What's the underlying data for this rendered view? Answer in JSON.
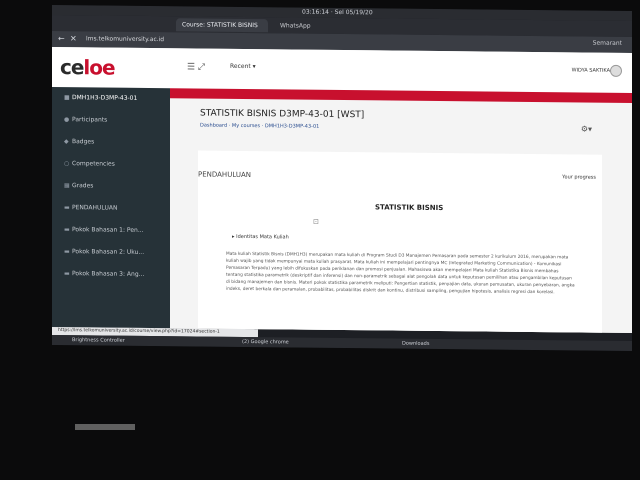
{
  "system": {
    "clock": "03:16:14 · Sel 05/19/20"
  },
  "browser": {
    "tabs": [
      {
        "label": "Course: STATISTIK BISNIS"
      },
      {
        "label": "WhatsApp"
      }
    ],
    "address": "lms.telkomuniversity.ac.id",
    "account": "Semarant",
    "status_url": "https://lms.telkomuniversity.ac.id/course/view.php?id=17024#section-1"
  },
  "site": {
    "logo_left": "ce",
    "logo_right": "loe",
    "recent_label": "Recent",
    "user_name": "WIDYA SAKTIKA"
  },
  "sidebar": {
    "items": [
      {
        "label": "DMH1H3-D3MP-43-01",
        "icon": "hat-icon"
      },
      {
        "label": "Participants",
        "icon": "users-icon"
      },
      {
        "label": "Badges",
        "icon": "badge-icon"
      },
      {
        "label": "Competencies",
        "icon": "check-icon"
      },
      {
        "label": "Grades",
        "icon": "grades-icon"
      },
      {
        "label": "PENDAHULUAN",
        "icon": "folder-icon"
      },
      {
        "label": "Pokok Bahasan 1: Pen...",
        "icon": "folder-icon"
      },
      {
        "label": "Pokok Bahasan 2: Uku...",
        "icon": "folder-icon"
      },
      {
        "label": "Pokok Bahasan 3: Ang...",
        "icon": "folder-icon"
      }
    ]
  },
  "course": {
    "title": "STATISTIK BISNIS D3MP-43-01 [WST]",
    "breadcrumb": [
      "Dashboard",
      "My courses",
      "DMH1H3-D3MP-43-01"
    ],
    "section_title": "PENDAHULUAN",
    "progress_label": "Your progress",
    "heading": "STATISTIK BISNIS",
    "identitas_label": "Identitas Mata Kuliah",
    "paragraph": "Mata kuliah Statistik Bisnis (DMH1H3) merupakan mata kuliah di Program Studi D3 Manajemen Pemasaran pada semester 2 kurikulum 2016, merupakan mata kuliah wajib yang tidak mempunyai mata kuliah prasyarat. Mata kuliah ini mempelajari pentingnya MC (Integrated Marketing Communication) - Komunikasi Pemasaran Terpadu) yang lebih difokuskan pada periklanan dan promosi penjualan. Mahasiswa akan mempelajari Mata kuliah Statistika Bisnis membahas tentang statistika parametrik (deskriptif dan inferensi) dan non-parametrik sebagai alat pengolah data untuk keputusan pemilihan atau pengambilan keputusan di bidang manajemen dan bisnis. Materi pokok statistika parametrik meliputi: Pengertian statistik, penyajian data, ukuran pemusatan, ukuran penyebaran, angka indeks, deret berkala dan peramalan, probabilitas, probabilitas diskrit dan kontinu, distribusi sampling, pengujian hipotesis, analisis regresi dan korelasi."
  },
  "taskbar": {
    "items": [
      "Brightness Controller",
      "(2) Google chrome",
      "Downloads"
    ]
  }
}
